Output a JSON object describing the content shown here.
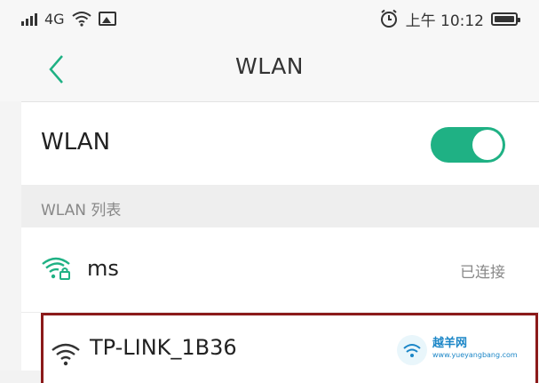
{
  "status_bar": {
    "network": "4G",
    "time": "上午 10:12",
    "icons": [
      "signal-icon",
      "wifi-icon",
      "image-icon",
      "alarm-icon",
      "battery-icon"
    ]
  },
  "header": {
    "title": "WLAN",
    "back_icon": "chevron-left-icon"
  },
  "wlan_toggle": {
    "label": "WLAN",
    "state": "on",
    "accent": "#1fb184"
  },
  "section": {
    "title": "WLAN 列表"
  },
  "networks": [
    {
      "name": "ms",
      "status": "已连接",
      "secured": true
    },
    {
      "name": "TP-LINK_1B36",
      "status": "",
      "secured": false
    }
  ],
  "highlight_color": "#8b1a1a",
  "watermark": {
    "title": "越羊网",
    "url": "www.yueyangbang.com"
  }
}
